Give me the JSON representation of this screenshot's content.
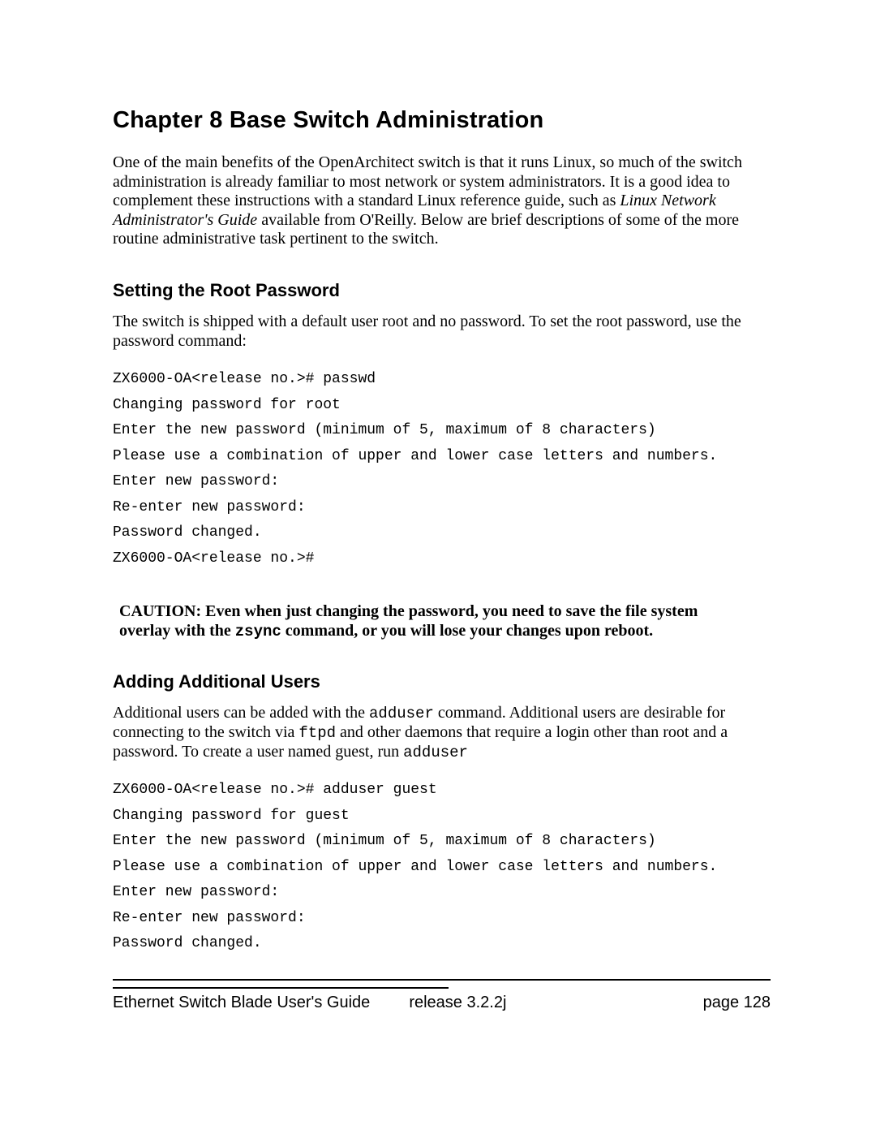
{
  "chapter": {
    "title": "Chapter 8   Base Switch Administration"
  },
  "intro": {
    "part1": "One of the main benefits of the OpenArchitect switch is that it runs Linux, so much of the switch administration is already familiar to most network or system administrators. It is  a good idea to complement these instructions with a standard Linux reference guide, such as ",
    "book": "Linux Network Administrator's Guide",
    "part2": " available from O'Reilly. Below are brief descriptions of some of the more routine administrative task pertinent to the switch."
  },
  "section1": {
    "heading": "Setting the Root Password",
    "para": "The switch is shipped with a default user root and no password. To set the root password, use the password command:",
    "code": "ZX6000-OA<release no.># passwd\nChanging password for root\nEnter the new password (minimum of 5, maximum of 8 characters)\nPlease use a combination of upper and lower case letters and numbers.\nEnter new password:\nRe-enter new password:\nPassword changed.\nZX6000-OA<release no.>#"
  },
  "caution": {
    "prefix": "CAUTION: Even when just changing the password, you need to save the file system overlay with the ",
    "cmd": "zsync",
    "suffix": " command, or you will lose your changes upon reboot."
  },
  "section2": {
    "heading": "Adding Additional Users",
    "para_a": "Additional users can be added with the ",
    "cmd1": "adduser",
    "para_b": " command. Additional users are desirable for connecting to the switch via ",
    "cmd2": "ftpd",
    "para_c": " and other daemons that require a login other than root and a password. To create a user named guest, run ",
    "cmd3": "adduser",
    "code": "ZX6000-OA<release no.># adduser guest\nChanging password for guest\nEnter the new password (minimum of 5, maximum of 8 characters)\nPlease use a combination of upper and lower case letters and numbers.\nEnter new password:\nRe-enter new password:\nPassword changed."
  },
  "footer": {
    "doc_title": "Ethernet Switch Blade User's Guide",
    "release": "release  3.2.2j",
    "page": "page  128"
  }
}
